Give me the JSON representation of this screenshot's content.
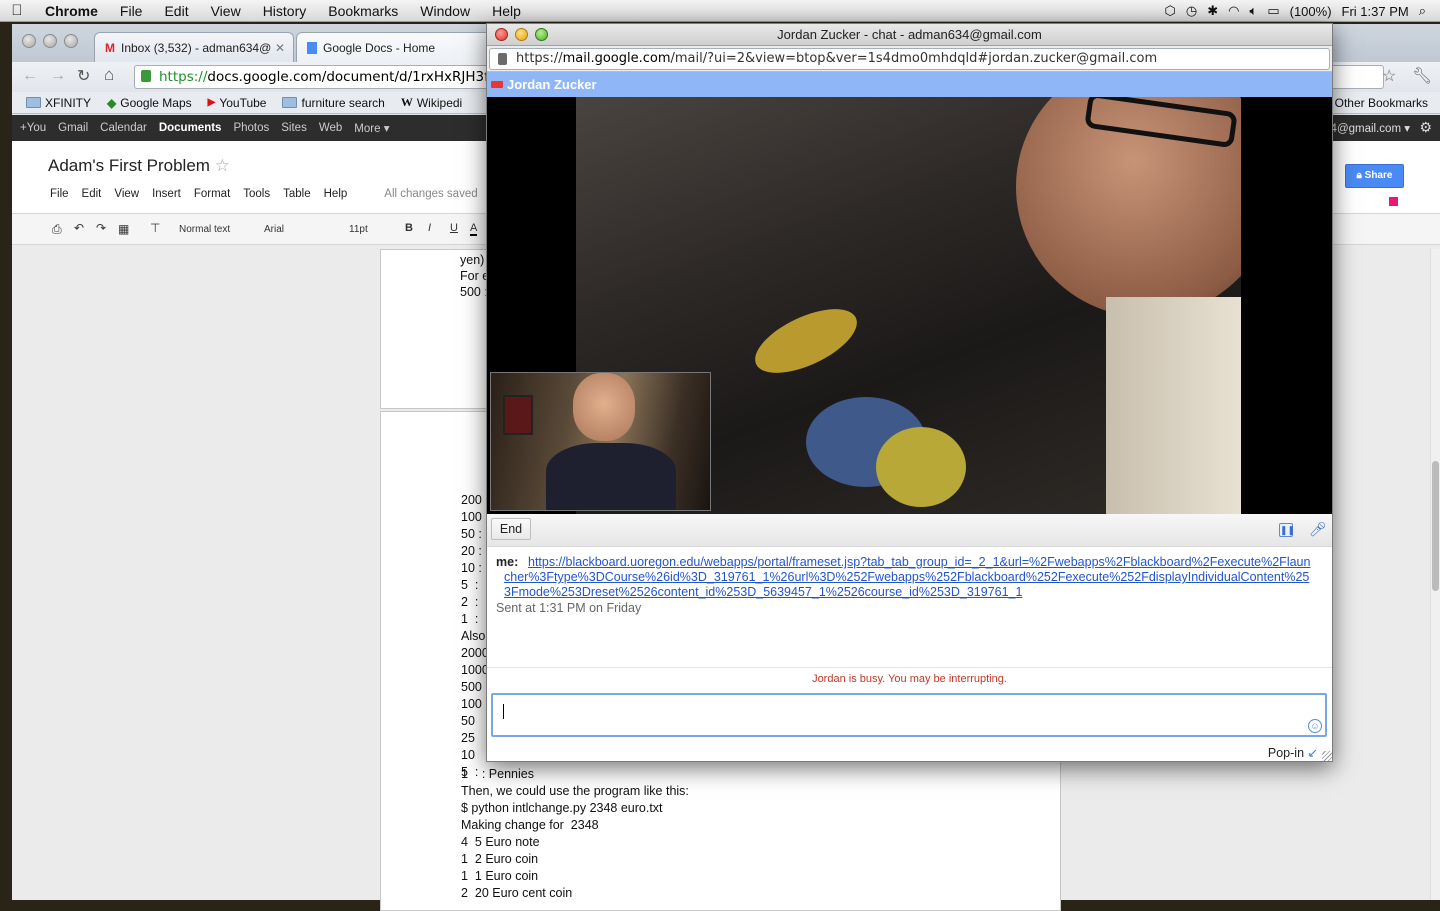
{
  "menubar": {
    "app": "Chrome",
    "items": [
      "File",
      "Edit",
      "View",
      "History",
      "Bookmarks",
      "Window",
      "Help"
    ],
    "battery": "(100%)",
    "clock": "Fri 1:37 PM"
  },
  "browser": {
    "tabs": [
      {
        "label": "Inbox (3,532) - adman634@"
      },
      {
        "label": "Google Docs - Home"
      }
    ],
    "url_scheme": "https://",
    "url_rest": "docs.google.com/document/d/1rxHxRJH3f",
    "bookmarks": [
      {
        "label": "XFINITY"
      },
      {
        "label": "Google Maps"
      },
      {
        "label": "YouTube"
      },
      {
        "label": "furniture search"
      },
      {
        "label": "Wikipedi"
      }
    ],
    "other_bookmarks": "Other Bookmarks"
  },
  "gbar": {
    "items": [
      "+You",
      "Gmail",
      "Calendar",
      "Documents",
      "Photos",
      "Sites",
      "Web",
      "More ▾"
    ],
    "active": "Documents",
    "account": "34@gmail.com ▾"
  },
  "doc": {
    "title": "Adam's First Problem",
    "menu": [
      "File",
      "Edit",
      "View",
      "Insert",
      "Format",
      "Tools",
      "Table",
      "Help"
    ],
    "saved_status": "All changes saved",
    "toolbar": {
      "style": "Normal text",
      "font": "Arial",
      "size": "11pt"
    },
    "share_label": "Share",
    "page1_lines": [
      "yen)",
      "For e",
      "500 :"
    ],
    "page2_left_lines": [
      "200 :",
      "100 :",
      "50 :",
      "20 :",
      "10 :",
      "5  :",
      "2  :",
      "1  :",
      "Also",
      "2000",
      "1000",
      "500",
      "100",
      "50",
      "25",
      "10",
      "5  :"
    ],
    "page2_full_lines": [
      "1    : Pennies",
      "Then, we could use the program like this:",
      "$ python intlchange.py 2348 euro.txt",
      "Making change for  2348",
      "4  5 Euro note",
      "1  2 Euro coin",
      "1  1 Euro coin",
      "2  20 Euro cent coin"
    ]
  },
  "chat": {
    "window_title": "Jordan Zucker - chat - adman634@gmail.com",
    "url_scheme": "https://",
    "url_domain": "mail.google.com",
    "url_path": "/mail/?ui=2&view=btop&ver=1s4dmo0mhdqld#jordan.zucker@gmail.com",
    "contact_name": "Jordan Zucker",
    "end_label": "End",
    "message_sender": "me:",
    "message_link": "https://blackboard.uoregon.edu/webapps/portal/frameset.jsp?tab_tab_group_id=_2_1&url=%2Fwebapps%2Fblackboard%2Fexecute%2Flauncher%3Ftype%3DCourse%26id%3D_319761_1%26url%3D%252Fwebapps%252Fblackboard%252Fexecute%252FdisplayIndividualContent%253Fmode%253Dreset%2526content_id%253D_5639457_1%2526course_id%253D_319761_1",
    "sent_status": "Sent at 1:31 PM on Friday",
    "busy_notice": "Jordan is busy. You may be interrupting.",
    "input_value": "",
    "popin_label": "Pop-in"
  }
}
